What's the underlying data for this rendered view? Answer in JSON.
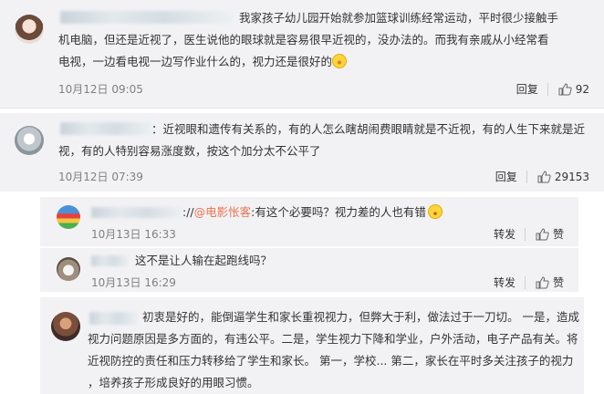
{
  "comments": [
    {
      "text_l1": "我家孩子幼儿园开始就参加篮球训练经常运动，平时很少接触手",
      "text_l2": "机电脑，但还是近视了，医生说他的眼球就是容易很早近视的，没办法的。而我有亲戚从小经常看",
      "text_l3": "电视，一边看电视一边写作业什么的，视力还是很好的",
      "time": "10月12日 09:05",
      "reply": "回复",
      "likes": "92"
    },
    {
      "text_l1": "：近视眼和遗传有关系的，有的人怎么瞎胡闹费眼睛就是不近视，有的人生下来就是近",
      "text_l2": "视，有的人特别容易涨度数，按这个加分太不公平了",
      "time": "10月12日 07:39",
      "reply": "回复",
      "likes": "29153"
    }
  ],
  "replies": [
    {
      "prefix": "://",
      "mention": "@电影怅客",
      "text": ":有这个必要吗？视力差的人也有错",
      "time": "10月13日 16:33",
      "forward": "转发",
      "like": "赞"
    },
    {
      "text": "这不是让人输在起跑线吗？",
      "time": "10月13日 16:29",
      "forward": "转发",
      "like": "赞"
    }
  ],
  "last_comment": {
    "l1": "初衷是好的，能倒逼学生和家长重视视力，但弊大于利，做法过于一刀切。 一是，造成",
    "l2": "视力问题原因是多方面的，有违公平。二是，学生视力下降和学业，户外活动，电子产品有关。将",
    "l3": "近视防控的责任和压力转移给了学生和家长。 第一，学校... 第二，家长在平时多关注孩子的视力",
    "l4": "，培养孩子形成良好的用眼习惯。"
  },
  "colors": {
    "link": "#eb7350",
    "card_bg": "#f2f2f5",
    "time": "#808080"
  }
}
